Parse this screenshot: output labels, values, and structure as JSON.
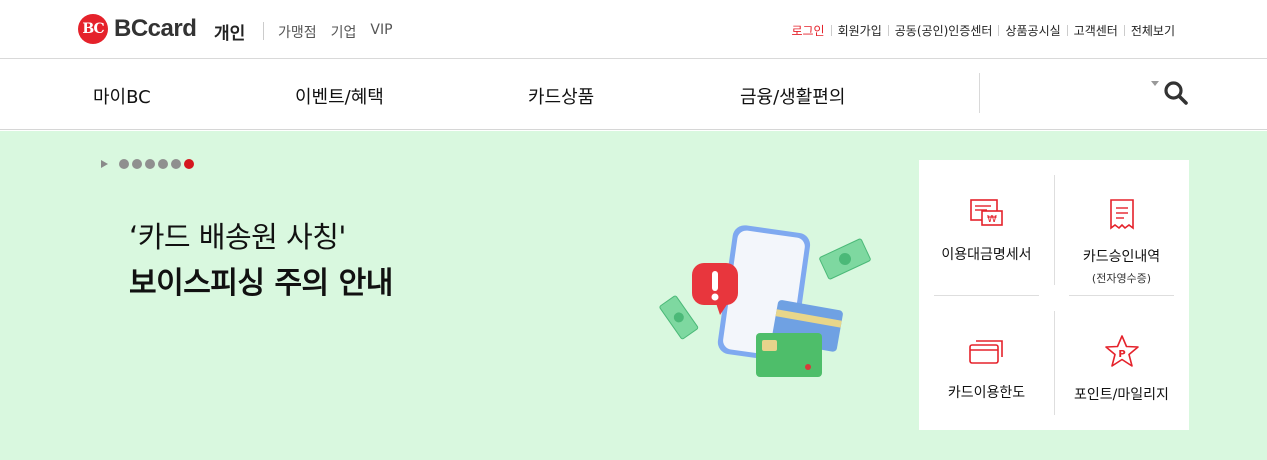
{
  "header": {
    "brand": "BCcard",
    "brand_mark": "BC",
    "segment_current": "개인",
    "segments": [
      "가맹점",
      "기업",
      "VIP"
    ],
    "util_links": [
      "로그인",
      "회원가입",
      "공동(공인)인증센터",
      "상품공시실",
      "고객센터",
      "전체보기"
    ]
  },
  "gnb": {
    "items": [
      "마이BC",
      "이벤트/혜택",
      "카드상품",
      "금융/생활편의"
    ]
  },
  "hero": {
    "title_line1": "‘카드 배송원 사칭'",
    "title_line2": "보이스피싱 주의 안내",
    "slide_count": 6,
    "active_slide": 6
  },
  "quick_menu": [
    {
      "label": "이용대금명세서",
      "sub": "",
      "icon": "statement-icon"
    },
    {
      "label": "카드승인내역",
      "sub": "(전자영수증)",
      "icon": "receipt-icon"
    },
    {
      "label": "카드이용한도",
      "sub": "",
      "icon": "card-limit-icon"
    },
    {
      "label": "포인트/마일리지",
      "sub": "",
      "icon": "point-star-icon"
    }
  ],
  "colors": {
    "accent": "#e5222b",
    "hero_bg": "#d9f8df",
    "active_dot": "#d5171f"
  }
}
